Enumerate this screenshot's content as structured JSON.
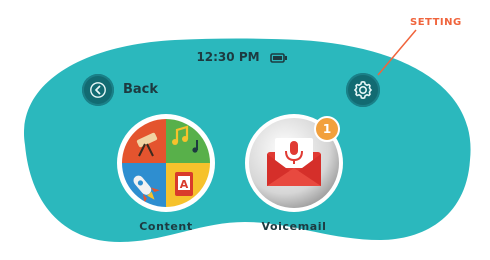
{
  "annotation": {
    "label": "SETTING"
  },
  "status_bar": {
    "time": "12:30 PM",
    "battery_icon": "battery-icon"
  },
  "header": {
    "back_label": "Back",
    "back_icon": "chevron-left-icon",
    "settings_icon": "gear-icon"
  },
  "apps": [
    {
      "label": "Content",
      "icon": "content-collage-icon"
    },
    {
      "label": "Voicemail",
      "icon": "mail-microphone-icon",
      "badge": "1"
    }
  ],
  "colors": {
    "frame": "#2bb8bd",
    "button": "#126b72",
    "accent_orange": "#f0643c",
    "badge": "#f2a03c",
    "text_dark": "#1d3a40"
  }
}
